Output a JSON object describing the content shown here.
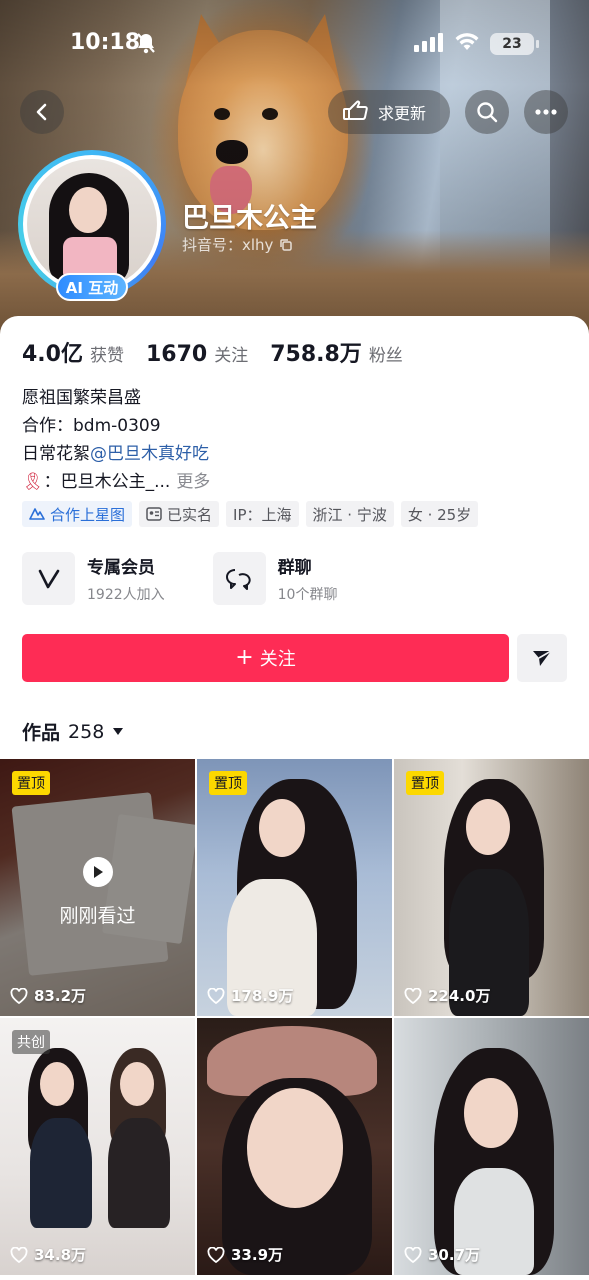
{
  "status_bar": {
    "time": "10:18",
    "battery": "23"
  },
  "top_actions": {
    "request_update_label": "求更新"
  },
  "profile": {
    "nickname": "巴旦木公主",
    "douyin_id": "抖音号：xlhy",
    "ai_badge": "AI 互动"
  },
  "stats": [
    {
      "value": "4.0亿",
      "label": "获赞"
    },
    {
      "value": "1670",
      "label": "关注"
    },
    {
      "value": "758.8万",
      "label": "粉丝"
    }
  ],
  "bio": {
    "line1": "愿祖国繁荣昌盛",
    "line2": "合作：bdm-0309",
    "line3_prefix": "日常花絮",
    "line3_mention": "@巴旦木真好吃",
    "line4_emoji": "🎗",
    "line4_text": "：巴旦木公主_...",
    "more": "更多"
  },
  "tags": {
    "star_map": "合作上星图",
    "verified": "已实名",
    "ip": "IP：上海",
    "location": "浙江 · 宁波",
    "gender_age": "女 · 25岁"
  },
  "features": [
    {
      "title": "专属会员",
      "subtitle": "1922人加入"
    },
    {
      "title": "群聊",
      "subtitle": "10个群聊"
    }
  ],
  "follow_button": "关注",
  "works": {
    "label": "作品",
    "count": "258"
  },
  "grid": [
    {
      "badge": "置顶",
      "likes": "83.2万",
      "overlay": "刚刚看过"
    },
    {
      "badge": "置顶",
      "likes": "178.9万"
    },
    {
      "badge": "置顶",
      "likes": "224.0万"
    },
    {
      "badge": "共创",
      "likes": "34.8万"
    },
    {
      "badge": "",
      "likes": "33.9万"
    },
    {
      "badge": "",
      "likes": "30.7万"
    }
  ],
  "colors": {
    "accent": "#fe2c55",
    "pin": "#fcd800",
    "mention": "#2d5fa8"
  }
}
